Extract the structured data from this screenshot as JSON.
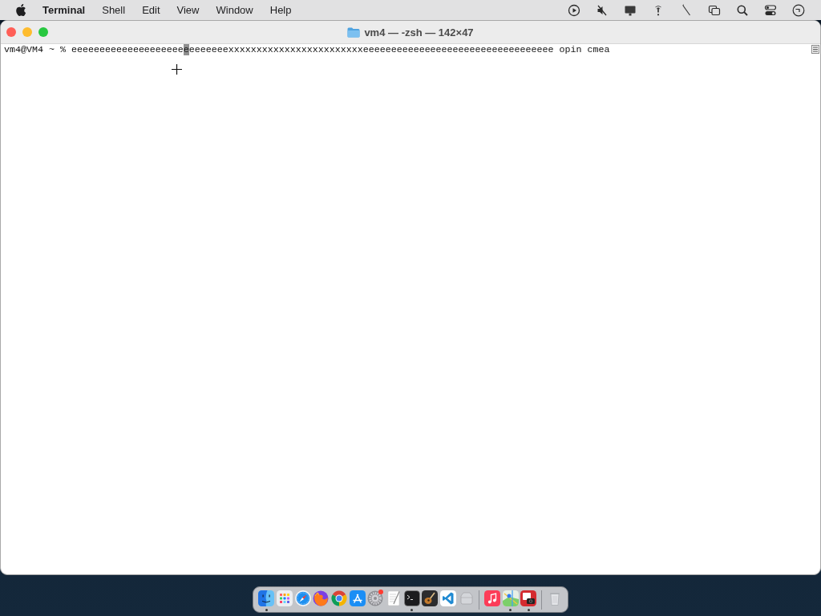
{
  "menu_bar": {
    "menus": [
      {
        "label": "Terminal",
        "kind": "app"
      },
      {
        "label": "Shell",
        "kind": "menu"
      },
      {
        "label": "Edit",
        "kind": "menu"
      },
      {
        "label": "View",
        "kind": "menu"
      },
      {
        "label": "Window",
        "kind": "menu"
      },
      {
        "label": "Help",
        "kind": "menu"
      }
    ]
  },
  "window": {
    "title": "vm4 — -zsh — 142×47",
    "lines": [
      {
        "prompt": "vm4@VM4 ~ %",
        "before_cursor": "eeeeeeeeeeeeeeeeeeee",
        "cursor_char": "e",
        "after_cursor": "eeeeeeexxxxxxxxxxxxxxxxxxxxxxxxeeeeeeeeeeeeeeeeeeeeeeeeeeeeeeeeee opin cmea"
      }
    ]
  },
  "dock": {
    "groups": [
      {
        "items": [
          {
            "kind": "face",
            "running": true,
            "badge": false
          },
          {
            "kind": "grid",
            "running": false,
            "badge": false
          },
          {
            "kind": "compass",
            "running": false,
            "badge": false
          },
          {
            "kind": "fox",
            "running": false,
            "badge": false
          },
          {
            "kind": "ring",
            "running": false,
            "badge": false
          },
          {
            "kind": "letter",
            "running": false,
            "badge": false
          },
          {
            "kind": "gear",
            "running": false,
            "badge": true
          },
          {
            "kind": "notepad",
            "running": false,
            "badge": false
          },
          {
            "kind": "console",
            "running": true,
            "badge": false
          },
          {
            "kind": "guitar",
            "running": false,
            "badge": false
          },
          {
            "kind": "ribbon",
            "running": false,
            "badge": false
          },
          {
            "kind": "tray",
            "running": false,
            "badge": false
          }
        ]
      },
      {
        "items": [
          {
            "kind": "note",
            "running": false,
            "badge": false
          },
          {
            "kind": "map",
            "running": true,
            "badge": false
          },
          {
            "kind": "camera",
            "running": true,
            "badge": false
          }
        ]
      },
      {
        "items": [
          {
            "kind": "trash",
            "running": false,
            "badge": false
          }
        ]
      }
    ]
  }
}
